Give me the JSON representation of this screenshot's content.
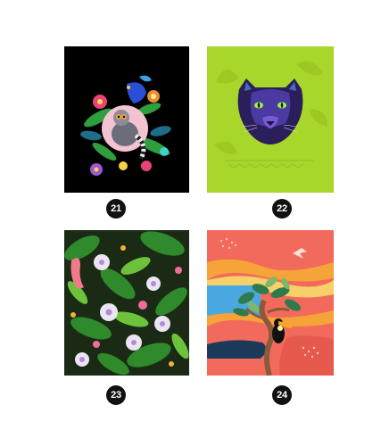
{
  "items": [
    {
      "number": "21",
      "subject": "lemur-tropical-floral-art",
      "background": "#000000"
    },
    {
      "number": "22",
      "subject": "panther-on-lime-jungle-art",
      "background": "#a9d62b"
    },
    {
      "number": "23",
      "subject": "tropical-leaves-and-flowers-pattern",
      "background": "#1b2a14"
    },
    {
      "number": "24",
      "subject": "toucan-tree-abstract-art",
      "background": "#f26a5b"
    }
  ]
}
